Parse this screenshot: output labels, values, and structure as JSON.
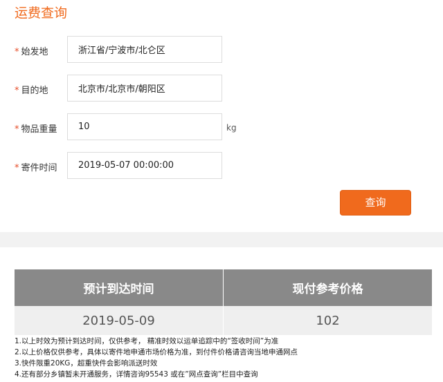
{
  "page_title": "运费查询",
  "form": {
    "required_mark": "*",
    "origin": {
      "label": "始发地",
      "value": "浙江省/宁波市/北仑区"
    },
    "destination": {
      "label": "目的地",
      "value": "北京市/北京市/朝阳区"
    },
    "weight": {
      "label": "物品重量",
      "value": "10",
      "unit": "kg"
    },
    "send_time": {
      "label": "寄件时间",
      "value": "2019-05-07 00:00:00"
    },
    "query_button": "查询"
  },
  "result": {
    "headers": [
      "预计到达时间",
      "现付参考价格"
    ],
    "values": [
      "2019-05-09",
      "102"
    ]
  },
  "notes": [
    "1.以上时效为预计到达时间，仅供参考， 精准时效以运单追踪中的“签收时间”为准",
    "2.以上价格仅供参考，具体以寄件地申通市场价格为准，到付件价格请咨询当地申通网点",
    "3.快件限重20KG，超重快件会影响派送时效",
    "4.还有部分乡镇暂未开通服务，详情咨询95543 或在”网点查询”栏目中查询"
  ],
  "colors": {
    "accent": "#f06a1d",
    "header_bg": "#898989",
    "cell_bg": "#efefef"
  }
}
